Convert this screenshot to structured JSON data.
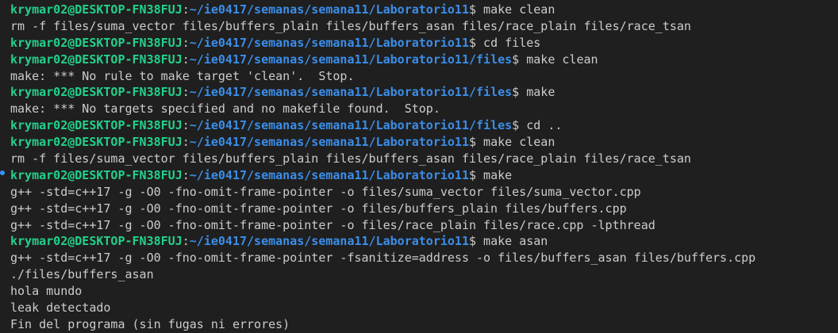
{
  "theme": {
    "background": "#1f1f1f",
    "text": "#cccccc",
    "user_color": "#23d18b",
    "path_color": "#3b8eea",
    "marker_color": "#3794ff"
  },
  "terminal": {
    "lines": [
      {
        "kind": "prompt",
        "user": "krymar02@DESKTOP-FN38FUJ",
        "sep": ":",
        "path": "~/ie0417/semanas/semana11/Laboratorio11",
        "dollar": "$",
        "cmd": " make clean"
      },
      {
        "kind": "output",
        "text": "rm -f files/suma_vector files/buffers_plain files/buffers_asan files/race_plain files/race_tsan"
      },
      {
        "kind": "prompt",
        "user": "krymar02@DESKTOP-FN38FUJ",
        "sep": ":",
        "path": "~/ie0417/semanas/semana11/Laboratorio11",
        "dollar": "$",
        "cmd": " cd files"
      },
      {
        "kind": "prompt",
        "user": "krymar02@DESKTOP-FN38FUJ",
        "sep": ":",
        "path": "~/ie0417/semanas/semana11/Laboratorio11/files",
        "dollar": "$",
        "cmd": " make clean"
      },
      {
        "kind": "output",
        "text": "make: *** No rule to make target 'clean'.  Stop."
      },
      {
        "kind": "prompt",
        "user": "krymar02@DESKTOP-FN38FUJ",
        "sep": ":",
        "path": "~/ie0417/semanas/semana11/Laboratorio11/files",
        "dollar": "$",
        "cmd": " make"
      },
      {
        "kind": "output",
        "text": "make: *** No targets specified and no makefile found.  Stop."
      },
      {
        "kind": "prompt",
        "user": "krymar02@DESKTOP-FN38FUJ",
        "sep": ":",
        "path": "~/ie0417/semanas/semana11/Laboratorio11/files",
        "dollar": "$",
        "cmd": " cd .."
      },
      {
        "kind": "prompt",
        "user": "krymar02@DESKTOP-FN38FUJ",
        "sep": ":",
        "path": "~/ie0417/semanas/semana11/Laboratorio11",
        "dollar": "$",
        "cmd": " make clean"
      },
      {
        "kind": "output",
        "text": "rm -f files/suma_vector files/buffers_plain files/buffers_asan files/race_plain files/race_tsan"
      },
      {
        "kind": "prompt",
        "user": "krymar02@DESKTOP-FN38FUJ",
        "sep": ":",
        "path": "~/ie0417/semanas/semana11/Laboratorio11",
        "dollar": "$",
        "cmd": " make"
      },
      {
        "kind": "output",
        "text": "g++ -std=c++17 -g -O0 -fno-omit-frame-pointer -o files/suma_vector files/suma_vector.cpp"
      },
      {
        "kind": "output",
        "text": "g++ -std=c++17 -g -O0 -fno-omit-frame-pointer -o files/buffers_plain files/buffers.cpp"
      },
      {
        "kind": "output",
        "text": "g++ -std=c++17 -g -O0 -fno-omit-frame-pointer -o files/race_plain files/race.cpp -lpthread"
      },
      {
        "kind": "prompt",
        "user": "krymar02@DESKTOP-FN38FUJ",
        "sep": ":",
        "path": "~/ie0417/semanas/semana11/Laboratorio11",
        "dollar": "$",
        "cmd": " make asan"
      },
      {
        "kind": "output",
        "text": "g++ -std=c++17 -g -O0 -fno-omit-frame-pointer -fsanitize=address -o files/buffers_asan files/buffers.cpp"
      },
      {
        "kind": "output",
        "text": "./files/buffers_asan"
      },
      {
        "kind": "output",
        "text": "hola mundo"
      },
      {
        "kind": "output",
        "text": "leak detectado"
      },
      {
        "kind": "output",
        "text": "Fin del programa (sin fugas ni errores)"
      }
    ]
  }
}
